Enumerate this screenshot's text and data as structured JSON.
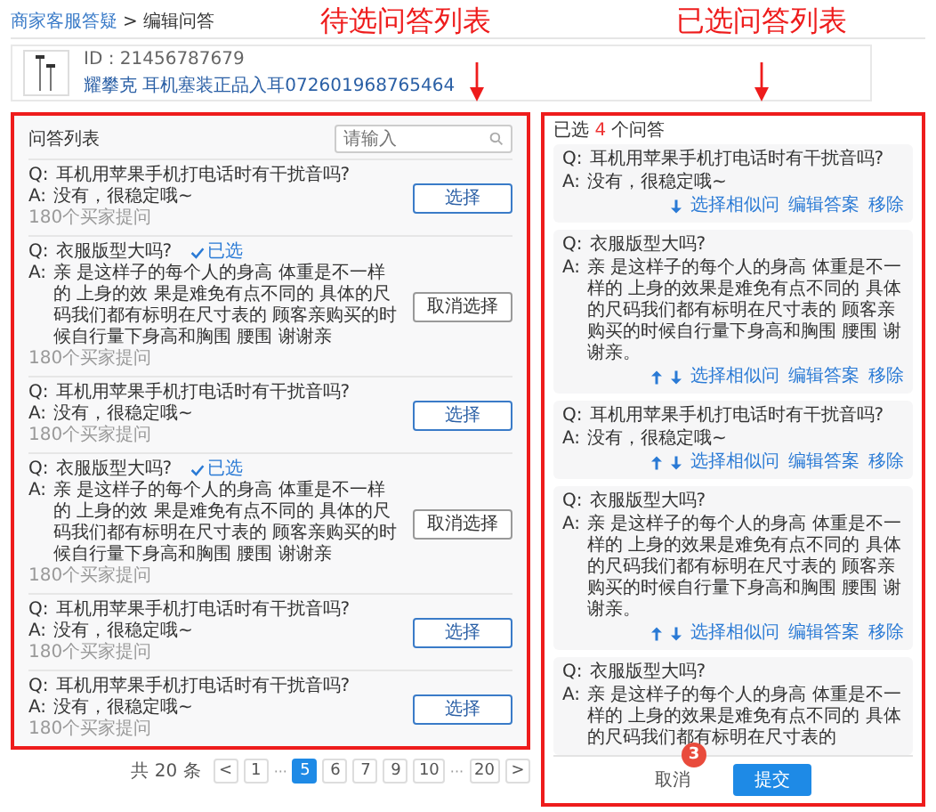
{
  "breadcrumb": {
    "parent": "商家客服答疑",
    "separator": ">",
    "current": "编辑问答"
  },
  "annotations": [
    {
      "text": "待选问答列表"
    },
    {
      "text": "已选问答列表"
    }
  ],
  "step_badge": "3",
  "product": {
    "id": "ID : 21456787679",
    "name": "耀攀克 耳机塞装正品入耳072601968765464"
  },
  "candidates": {
    "title": "问答列表",
    "search": {
      "placeholder": "请输入"
    },
    "items": [
      {
        "q_label": "Q:",
        "question": "耳机用苹果手机打电话时有干扰音吗?",
        "a_label": "A:",
        "answer": "没有，很稳定哦~",
        "asked": "180个买家提问",
        "selected": false,
        "button": "选择"
      },
      {
        "q_label": "Q:",
        "question": "衣服版型大吗?",
        "tag": "已选",
        "a_label": "A:",
        "answer": "亲 是这样子的每个人的身高 体重是不一样的 上身的效 果是难免有点不同的 具体的尺码我们都有标明在尺寸表的 顾客亲购买的时候自行量下身高和胸围 腰围 谢谢亲",
        "asked": "180个买家提问",
        "selected": true,
        "button": "取消选择"
      },
      {
        "q_label": "Q:",
        "question": "耳机用苹果手机打电话时有干扰音吗?",
        "a_label": "A:",
        "answer": "没有，很稳定哦~",
        "asked": "180个买家提问",
        "selected": false,
        "button": "选择"
      },
      {
        "q_label": "Q:",
        "question": "衣服版型大吗?",
        "tag": "已选",
        "a_label": "A:",
        "answer": "亲 是这样子的每个人的身高 体重是不一样的 上身的效 果是难免有点不同的 具体的尺码我们都有标明在尺寸表的 顾客亲购买的时候自行量下身高和胸围 腰围 谢谢亲",
        "asked": "180个买家提问",
        "selected": true,
        "button": "取消选择"
      },
      {
        "q_label": "Q:",
        "question": "耳机用苹果手机打电话时有干扰音吗?",
        "a_label": "A:",
        "answer": "没有，很稳定哦~",
        "asked": "180个买家提问",
        "selected": false,
        "button": "选择"
      },
      {
        "q_label": "Q:",
        "question": "耳机用苹果手机打电话时有干扰音吗?",
        "a_label": "A:",
        "answer": "没有，很稳定哦~",
        "asked": "180个买家提问",
        "selected": false,
        "button": "选择"
      }
    ]
  },
  "pagination": {
    "total": "共 20 条",
    "prev": "<",
    "next": ">",
    "pages": [
      {
        "kind": "page",
        "label": "1",
        "selected": false
      },
      {
        "kind": "ellipsis",
        "label": "···"
      },
      {
        "kind": "page",
        "label": "5",
        "selected": true
      },
      {
        "kind": "page",
        "label": "6",
        "selected": false
      },
      {
        "kind": "page",
        "label": "7",
        "selected": false
      },
      {
        "kind": "page",
        "label": "9",
        "selected": false
      },
      {
        "kind": "page",
        "label": "10",
        "selected": false
      },
      {
        "kind": "ellipsis",
        "label": "···"
      },
      {
        "kind": "page",
        "label": "20",
        "selected": false
      }
    ]
  },
  "chosen": {
    "count_prefix": "已选",
    "count": "4",
    "count_suffix": "个问答",
    "items": [
      {
        "q_label": "Q:",
        "question": "耳机用苹果手机打电话时有干扰音吗?",
        "a_label": "A:",
        "answer": "没有，很稳定哦~",
        "move_up": false,
        "move_down": true,
        "actions": [
          "选择相似问",
          "编辑答案",
          "移除"
        ]
      },
      {
        "q_label": "Q:",
        "question": "衣服版型大吗?",
        "a_label": "A:",
        "answer": "亲 是这样子的每个人的身高 体重是不一样的 上身的效果是难免有点不同的 具体的尺码我们都有标明在尺寸表的 顾客亲购买的时候自行量下身高和胸围 腰围 谢谢亲。",
        "move_up": true,
        "move_down": true,
        "actions": [
          "选择相似问",
          "编辑答案",
          "移除"
        ]
      },
      {
        "q_label": "Q:",
        "question": "耳机用苹果手机打电话时有干扰音吗?",
        "a_label": "A:",
        "answer": "没有，很稳定哦~",
        "move_up": true,
        "move_down": true,
        "actions": [
          "选择相似问",
          "编辑答案",
          "移除"
        ]
      },
      {
        "q_label": "Q:",
        "question": "衣服版型大吗?",
        "a_label": "A:",
        "answer": "亲 是这样子的每个人的身高 体重是不一样的 上身的效果是难免有点不同的 具体的尺码我们都有标明在尺寸表的 顾客亲购买的时候自行量下身高和胸围 腰围 谢谢亲。",
        "move_up": true,
        "move_down": true,
        "actions": [
          "选择相似问",
          "编辑答案",
          "移除"
        ]
      },
      {
        "q_label": "Q:",
        "question": "衣服版型大吗?",
        "a_label": "A:",
        "answer": "亲 是这样子的每个人的身高 体重是不一样的 上身的效果是难免有点不同的 具体的尺码我们都有标明在尺寸表的"
      }
    ]
  },
  "footer": {
    "cancel": "取消",
    "submit": "提交"
  }
}
